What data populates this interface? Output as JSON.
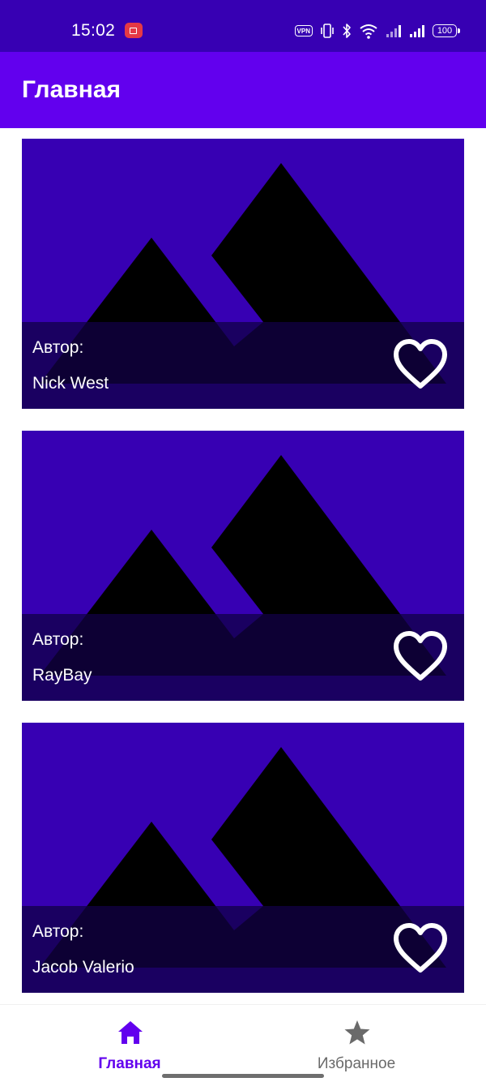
{
  "status_bar": {
    "time": "15:02",
    "vpn_label": "VPN",
    "battery_level": "100"
  },
  "app_bar": {
    "title": "Главная"
  },
  "feed": {
    "author_label": "Автор:",
    "cards": [
      {
        "author": "Nick West",
        "favorite": false
      },
      {
        "author": "RayBay",
        "favorite": false
      },
      {
        "author": "Jacob Valerio",
        "favorite": false
      }
    ]
  },
  "bottom_nav": {
    "items": [
      {
        "label": "Главная",
        "icon": "home-icon",
        "active": true
      },
      {
        "label": "Избранное",
        "icon": "star-icon",
        "active": false
      }
    ]
  },
  "colors": {
    "primary": "#6200ee",
    "primary_dark": "#3700b3",
    "image_placeholder_bg": "#3700b3",
    "inactive_nav": "#6a6a6a"
  }
}
